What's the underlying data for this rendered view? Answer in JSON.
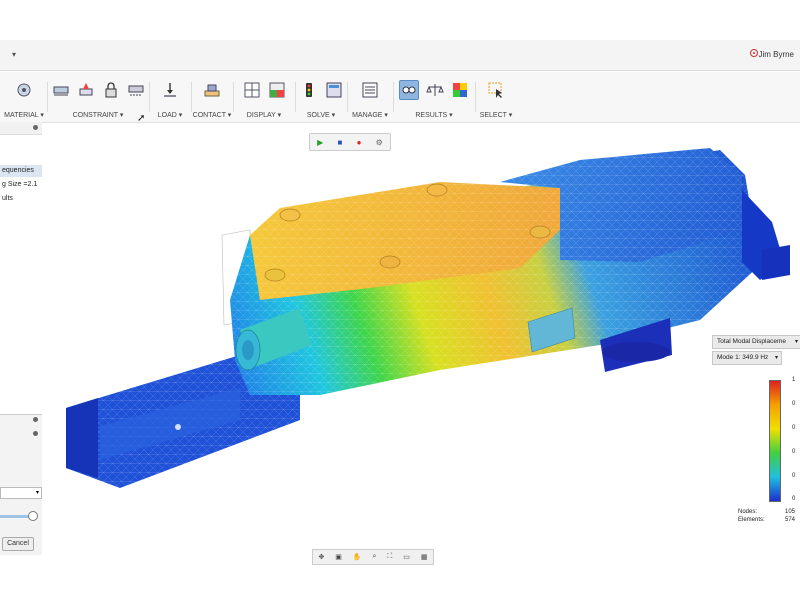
{
  "header": {
    "user": "Jim Byrne",
    "menu_caret": "▾"
  },
  "toolbar": {
    "groups": [
      {
        "label": "MATERIAL ▾"
      },
      {
        "label": "CONSTRAINT ▾"
      },
      {
        "label": "LOAD ▾"
      },
      {
        "label": "CONTACT ▾"
      },
      {
        "label": "DISPLAY ▾"
      },
      {
        "label": "SOLVE ▾"
      },
      {
        "label": "MANAGE ▾"
      },
      {
        "label": "RESULTS ▾"
      },
      {
        "label": "SELECT ▾"
      }
    ]
  },
  "browser": {
    "items": [
      {
        "label": "equencies",
        "selected": true
      },
      {
        "label": "g Size =2.1",
        "selected": false
      },
      {
        "label": "ults",
        "selected": false
      }
    ],
    "cancel_label": "Cancel"
  },
  "playback": {
    "play": "▶",
    "stop": "■",
    "record": "●",
    "settings": "⚙"
  },
  "results_panel": {
    "result_type": "Total Modal Displaceme",
    "mode": "Mode 1: 349.9 Hz",
    "legend_ticks": [
      "1",
      "0",
      "0",
      "0",
      "0",
      "0"
    ],
    "nodes_label": "Nodes:",
    "nodes_value": "105",
    "elements_label": "Elements:",
    "elements_value": "574"
  },
  "colors": {
    "high": "#e02020",
    "mid": "#f0e000",
    "low": "#1a30d0",
    "active_tool": "#8fb6e0"
  }
}
